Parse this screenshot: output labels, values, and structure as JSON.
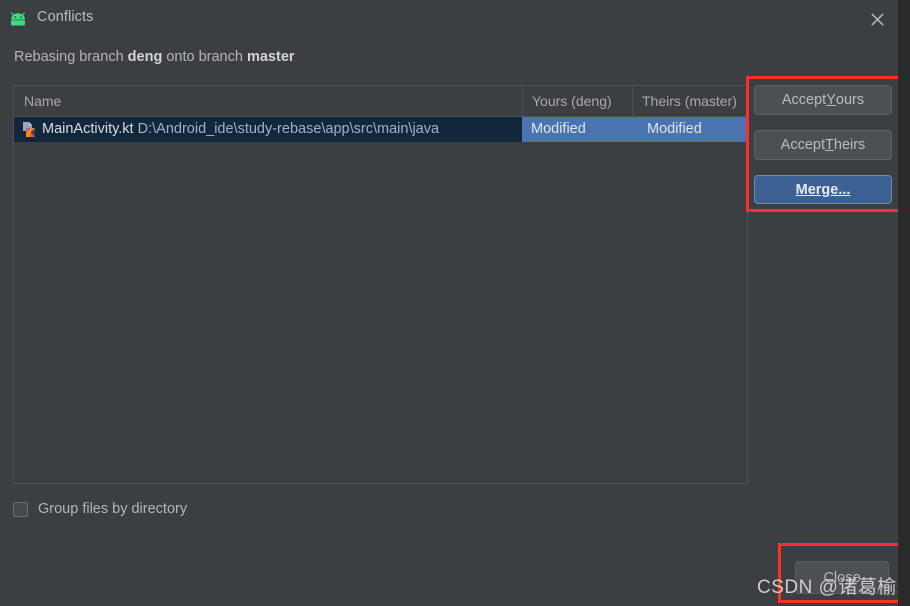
{
  "window": {
    "title": "Conflicts",
    "app_icon": "android-robot-icon",
    "close_icon": "close-icon"
  },
  "subtitle": {
    "prefix": "Rebasing branch ",
    "source_branch": "deng",
    "middle": " onto branch ",
    "target_branch": "master"
  },
  "table": {
    "columns": [
      "Name",
      "Yours (deng)",
      "Theirs (master)"
    ],
    "rows": [
      {
        "icon": "kotlin-file-icon",
        "file_name": "MainActivity.kt",
        "file_path": "D:\\Android_ide\\study-rebase\\app\\src\\main\\java",
        "yours": "Modified",
        "theirs": "Modified",
        "selected": true
      }
    ]
  },
  "options": {
    "group_files_label": "Group files by directory",
    "group_files_checked": false
  },
  "actions": {
    "accept_yours": {
      "before": "Accept ",
      "mnemonic": "Y",
      "after": "ours"
    },
    "accept_theirs": {
      "before": "Accept ",
      "mnemonic": "T",
      "after": "heirs"
    },
    "merge": {
      "mnemonic": "M",
      "after": "erge..."
    },
    "close": "Close"
  },
  "watermark": "CSDN @诸葛榆木",
  "colors": {
    "dialog_background": "#3c3f41",
    "panel_border": "#4f5254",
    "selection_blue": "#4a73b0",
    "selection_navy": "#13273b",
    "default_button": "#3c6091",
    "annotation_red": "#ff2d2d",
    "android_green": "#3ddc84",
    "text_primary": "#bbbbbb"
  }
}
